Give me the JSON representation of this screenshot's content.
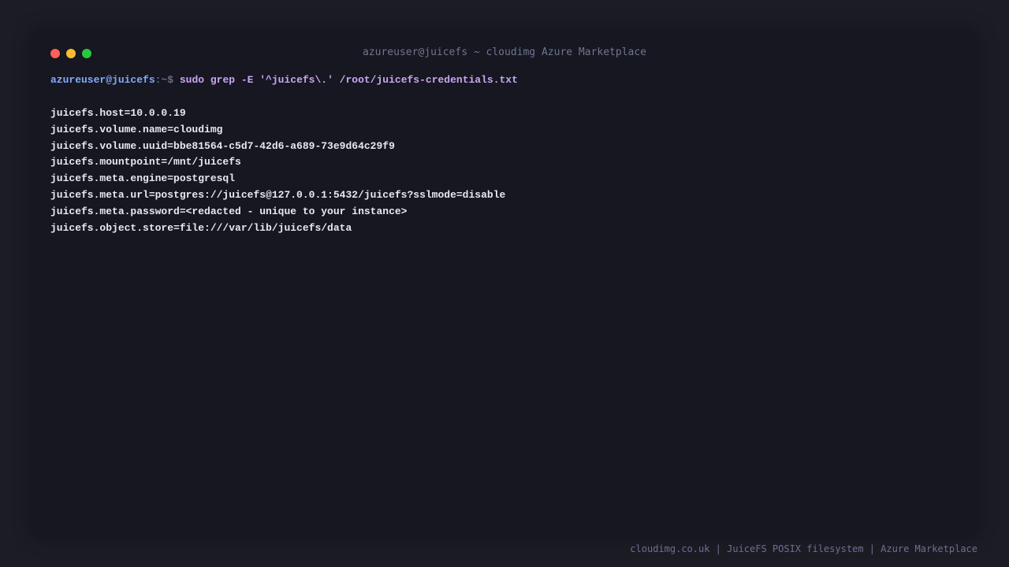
{
  "window": {
    "title": "azureuser@juicefs ~ cloudimg Azure Marketplace"
  },
  "prompt": {
    "user_host": "azureuser@juicefs",
    "path": ":~$",
    "command": "sudo grep -E '^juicefs\\.' /root/juicefs-credentials.txt"
  },
  "output_lines": [
    "juicefs.host=10.0.0.19",
    "juicefs.volume.name=cloudimg",
    "juicefs.volume.uuid=bbe81564-c5d7-42d6-a689-73e9d64c29f9",
    "juicefs.mountpoint=/mnt/juicefs",
    "juicefs.meta.engine=postgresql",
    "juicefs.meta.url=postgres://juicefs@127.0.0.1:5432/juicefs?sslmode=disable",
    "juicefs.meta.password=<redacted - unique to your instance>",
    "juicefs.object.store=file:///var/lib/juicefs/data"
  ],
  "footer": {
    "text": "cloudimg.co.uk | JuiceFS POSIX filesystem | Azure Marketplace"
  },
  "colors": {
    "background": "#1c1c25",
    "terminal_bg": "#161720",
    "prompt_user": "#82aaff",
    "prompt_cmd": "#c8a6f5",
    "output_text": "#e6e9f2",
    "close_dot": "#ff5f57",
    "minimize_dot": "#febc2e",
    "maximize_dot": "#28c840"
  }
}
